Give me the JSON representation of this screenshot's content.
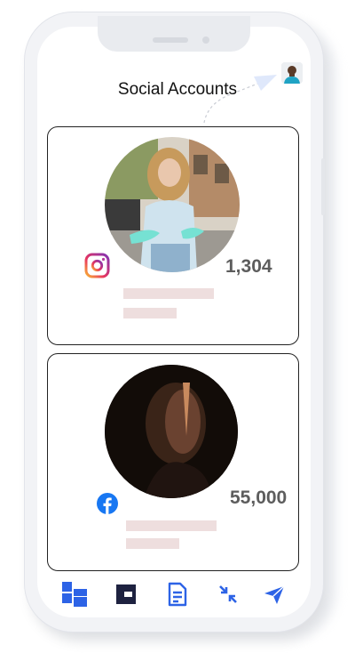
{
  "header": {
    "title": "Social Accounts"
  },
  "accounts": [
    {
      "platform_icon": "instagram-icon",
      "count": "1,304"
    },
    {
      "platform_icon": "facebook-icon",
      "count": "55,000"
    }
  ],
  "nav": {
    "items": [
      "dashboard-icon",
      "cards-icon",
      "document-icon",
      "collapse-arrows-icon",
      "send-icon"
    ]
  },
  "colors": {
    "accent": "#2d63e6",
    "dark_nav": "#1e2240",
    "placeholder_bar": "#eedede",
    "count_text": "#5d5d5d"
  }
}
